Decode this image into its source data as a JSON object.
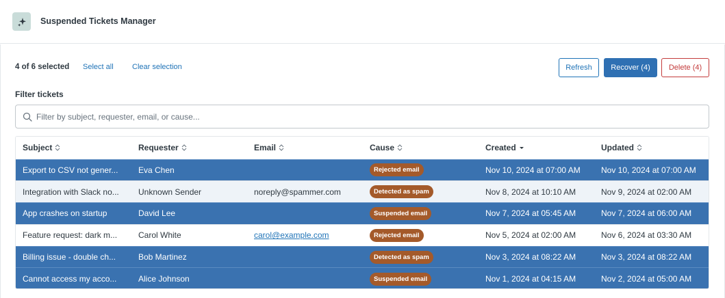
{
  "app": {
    "title": "Suspended Tickets Manager",
    "icon": "sparkle-icon",
    "icon_bg": "#c9dcd9"
  },
  "toolbar": {
    "selection_text": "4 of 6 selected",
    "select_all": "Select all",
    "clear_selection": "Clear selection",
    "refresh": "Refresh",
    "recover": "Recover (4)",
    "delete": "Delete (4)"
  },
  "filter": {
    "label": "Filter tickets",
    "placeholder": "Filter by subject, requester, email, or cause...",
    "value": ""
  },
  "table": {
    "columns": [
      "Subject",
      "Requester",
      "Email",
      "Cause",
      "Created",
      "Updated"
    ],
    "sorted_column": "Created",
    "sort_direction": "descending",
    "rows": [
      {
        "subject": "Export to CSV not gener...",
        "requester": "Eva Chen",
        "email": "",
        "cause": "Rejected email",
        "created": "Nov 10, 2024 at 07:00 AM",
        "updated": "Nov 10, 2024 at 07:00 AM",
        "selected": true
      },
      {
        "subject": "Integration with Slack no...",
        "requester": "Unknown Sender",
        "email": "noreply@spammer.com",
        "cause": "Detected as spam",
        "created": "Nov 8, 2024 at 10:10 AM",
        "updated": "Nov 9, 2024 at 02:00 AM",
        "selected": false
      },
      {
        "subject": "App crashes on startup",
        "requester": "David Lee",
        "email": "",
        "cause": "Suspended email",
        "created": "Nov 7, 2024 at 05:45 AM",
        "updated": "Nov 7, 2024 at 06:00 AM",
        "selected": true
      },
      {
        "subject": "Feature request: dark m...",
        "requester": "Carol White",
        "email": "carol@example.com",
        "cause": "Rejected email",
        "created": "Nov 5, 2024 at 02:00 AM",
        "updated": "Nov 6, 2024 at 03:30 AM",
        "selected": false
      },
      {
        "subject": "Billing issue - double ch...",
        "requester": "Bob Martinez",
        "email": "",
        "cause": "Detected as spam",
        "created": "Nov 3, 2024 at 08:22 AM",
        "updated": "Nov 3, 2024 at 08:22 AM",
        "selected": true
      },
      {
        "subject": "Cannot access my acco...",
        "requester": "Alice Johnson",
        "email": "",
        "cause": "Suspended email",
        "created": "Nov 1, 2024 at 04:15 AM",
        "updated": "Nov 2, 2024 at 05:00 AM",
        "selected": true
      }
    ]
  },
  "colors": {
    "accent": "#1f73b7",
    "selected_row": "#3a72b0",
    "badge": "#a45a2a",
    "danger": "#c33a3a"
  }
}
